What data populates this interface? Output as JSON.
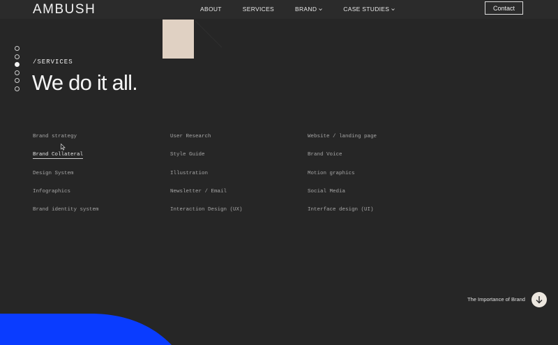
{
  "brand": {
    "logo": "AMBUSH"
  },
  "nav": {
    "items": [
      {
        "label": "ABOUT",
        "dropdown": false
      },
      {
        "label": "SERVICES",
        "dropdown": false
      },
      {
        "label": "BRAND",
        "dropdown": true
      },
      {
        "label": "CASE STUDIES",
        "dropdown": true
      }
    ],
    "contact_label": "Contact"
  },
  "pager": {
    "count": 6,
    "active_index": 2
  },
  "hero": {
    "eyebrow": "/SERVICES",
    "headline": "We do it all."
  },
  "services": {
    "columns": [
      [
        "Brand strategy",
        "Brand Collateral",
        "Design System",
        "Infographics",
        "Brand identity system"
      ],
      [
        "User Research",
        "Style Guide",
        "Illustration",
        "Newsletter / Email",
        "Interaction Design (UX)"
      ],
      [
        "Website / landing page",
        "Brand Voice",
        "Motion graphics",
        "Social Media",
        "Interface design (UI)"
      ]
    ],
    "active": "Brand Collateral"
  },
  "next_section": {
    "label": "The Importance of Brand",
    "icon": "arrow-down-icon"
  },
  "colors": {
    "background": "#262626",
    "header_bg": "#2b2b2b",
    "accent_blue": "#0a3cff",
    "card_beige": "#e0d1c3",
    "button_cream": "#ece7df"
  }
}
